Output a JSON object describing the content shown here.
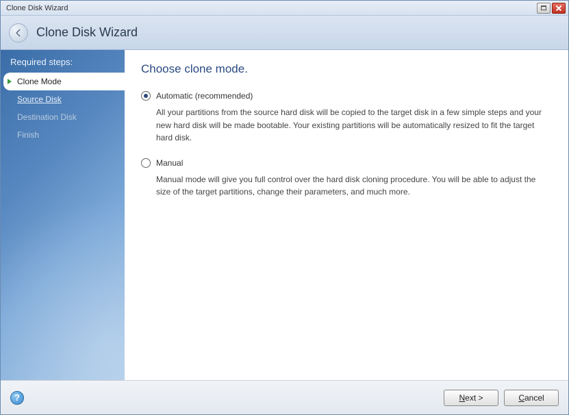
{
  "window": {
    "title": "Clone Disk Wizard"
  },
  "header": {
    "title": "Clone Disk Wizard"
  },
  "sidebar": {
    "header": "Required steps:",
    "steps": {
      "clone_mode": "Clone Mode",
      "source_disk": "Source Disk",
      "destination_disk": "Destination Disk",
      "finish": "Finish"
    }
  },
  "main": {
    "title": "Choose clone mode.",
    "options": {
      "automatic": {
        "label": "Automatic (recommended)",
        "desc": "All your partitions from the source hard disk will be copied to the target disk in a few simple steps and your new hard disk will be made bootable. Your existing partitions will be automatically resized to fit the target hard disk."
      },
      "manual": {
        "label": "Manual",
        "desc": "Manual mode will give you full control over the hard disk cloning procedure. You will be able to adjust the size of the target partitions, change their parameters, and much more."
      }
    }
  },
  "footer": {
    "help": "?",
    "next_prefix": "N",
    "next_rest": "ext >",
    "cancel_prefix": "C",
    "cancel_rest": "ancel"
  }
}
